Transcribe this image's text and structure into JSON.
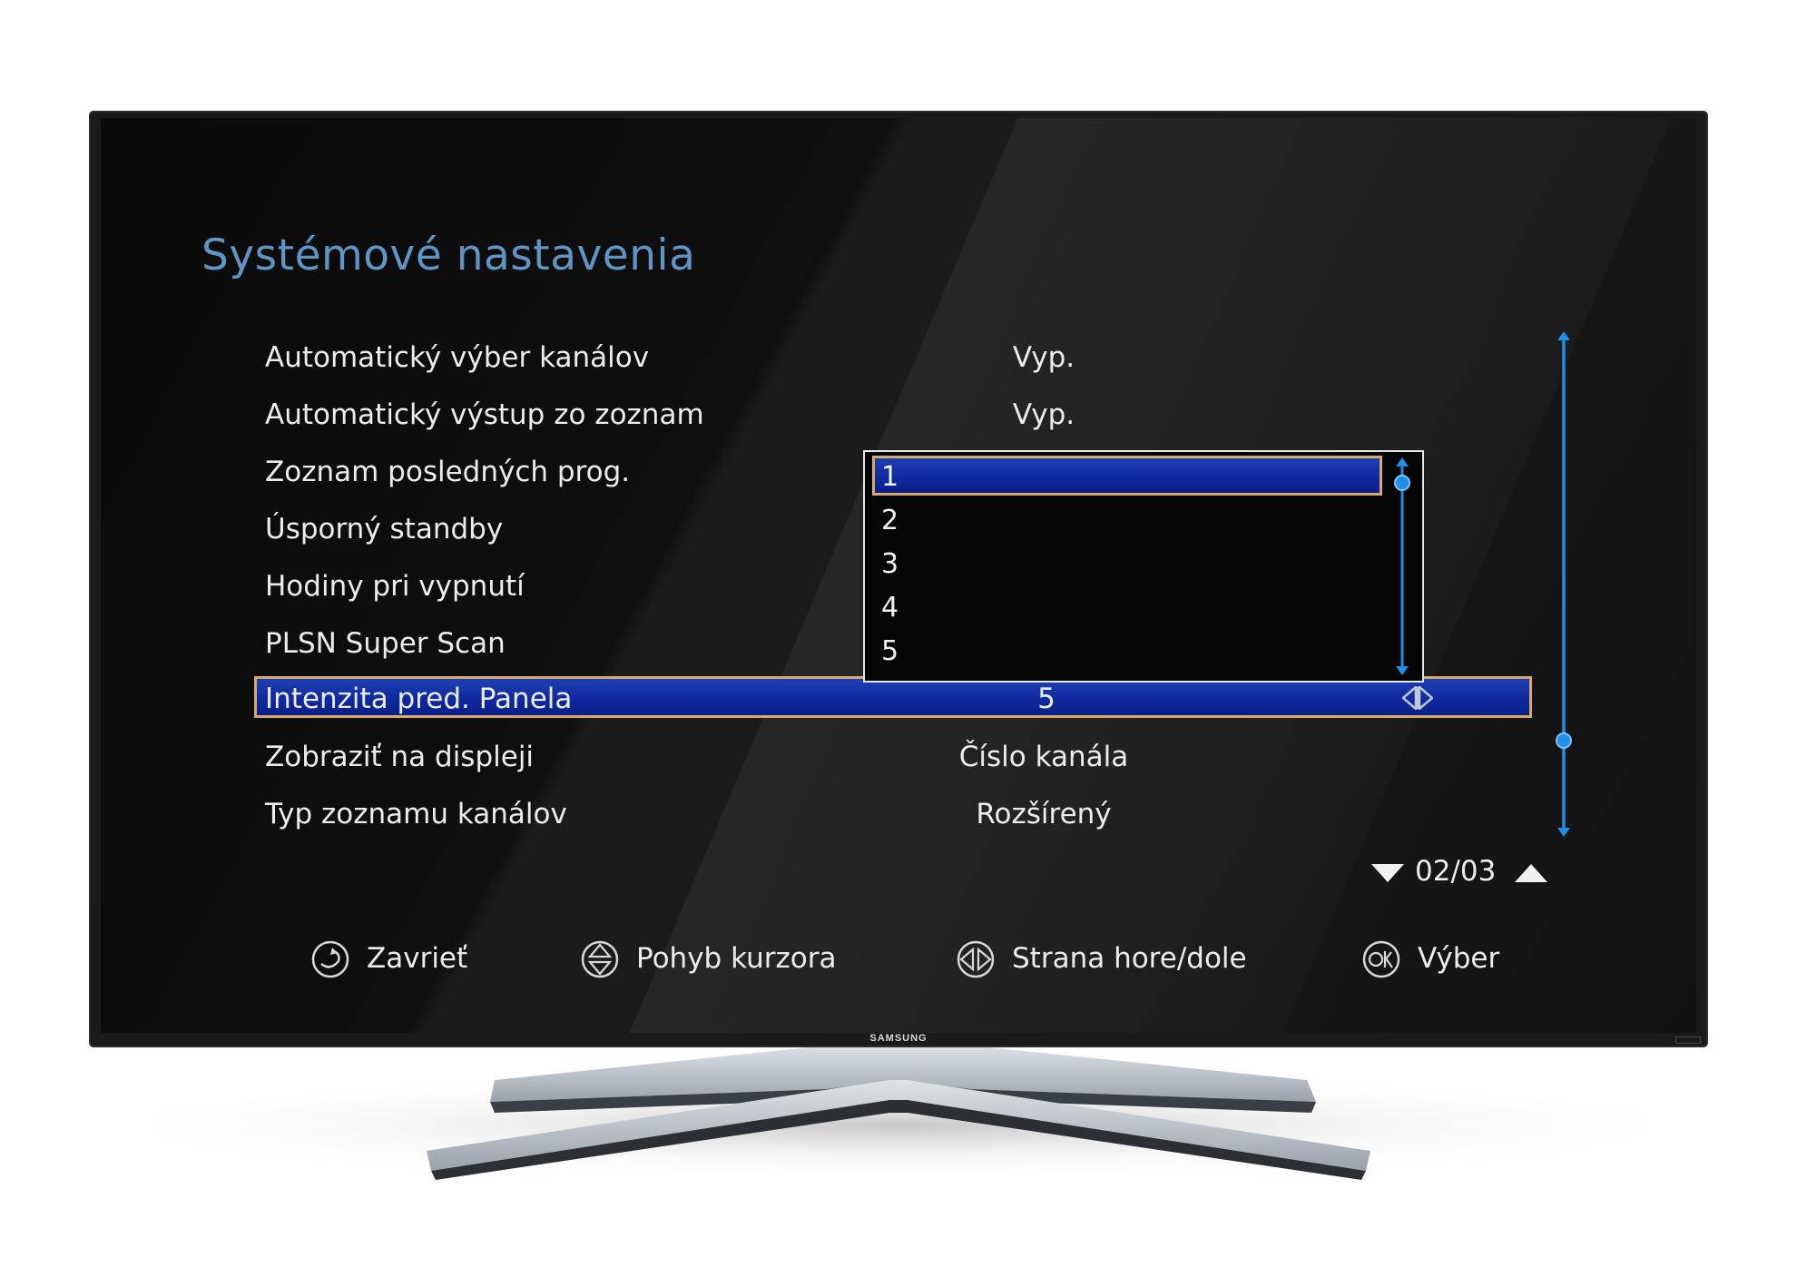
{
  "screen": {
    "title": "Systémové nastavenia",
    "brand": "SAMSUNG"
  },
  "menu": {
    "items": [
      {
        "label": "Automatický výber kanálov",
        "value": "Vyp."
      },
      {
        "label": "Automatický výstup zo zoznam",
        "value": "Vyp."
      },
      {
        "label": "Zoznam posledných prog.",
        "value": ""
      },
      {
        "label": "Úsporný standby",
        "value": ""
      },
      {
        "label": "Hodiny pri vypnutí",
        "value": ""
      },
      {
        "label": "PLSN Super Scan",
        "value": ""
      },
      {
        "label": "Intenzita pred. Panela",
        "value": "5"
      },
      {
        "label": "Zobraziť na displeji",
        "value": "Číslo kanála"
      },
      {
        "label": "Typ zoznamu kanálov",
        "value": "Rozšírený"
      }
    ],
    "selected_index": 6
  },
  "dropdown": {
    "options": [
      "1",
      "2",
      "3",
      "4",
      "5"
    ],
    "selected_index": 0
  },
  "pager": {
    "text": "02/03",
    "current_page": 2,
    "total_pages": 3
  },
  "hints": [
    {
      "icon": "back-icon",
      "label": "Zavrieť"
    },
    {
      "icon": "dpad-updown-icon",
      "label": "Pohyb kurzora"
    },
    {
      "icon": "dpad-leftright-icon",
      "label": "Strana hore/dole"
    },
    {
      "icon": "ok-icon",
      "label": "Výber"
    }
  ],
  "colors": {
    "title": "#5e95c4",
    "highlight": "#1f3fb2",
    "highlight_border": "#d9a96a",
    "scrollbar": "#1e8fe6"
  }
}
